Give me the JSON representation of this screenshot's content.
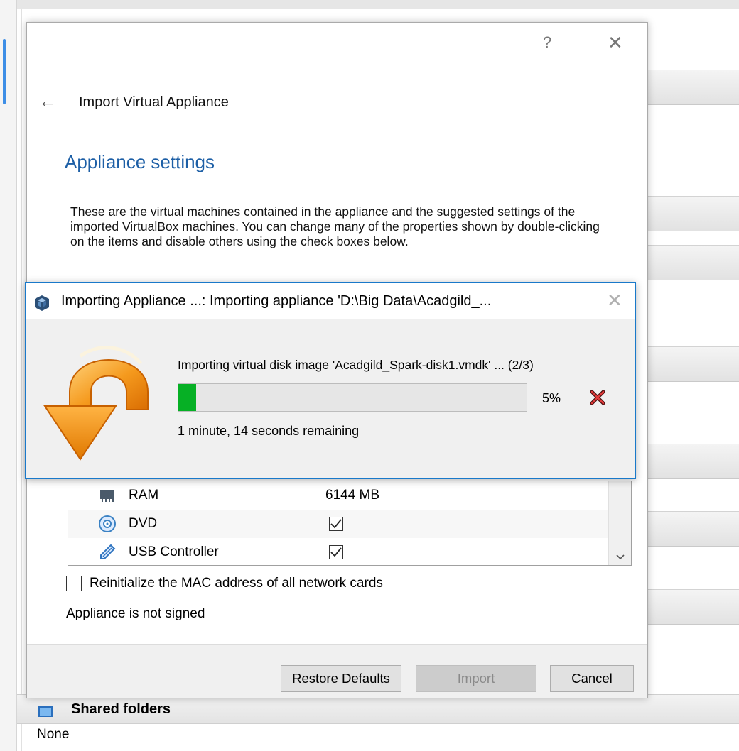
{
  "background": {
    "shared_folders_label": "Shared folders",
    "shared_folders_value": "None"
  },
  "dialog": {
    "help_glyph": "?",
    "close_glyph": "✕",
    "back_glyph": "←",
    "title": "Import Virtual Appliance",
    "section_title": "Appliance settings",
    "description": "These are the virtual machines contained in the appliance and the suggested settings of the imported VirtualBox machines. You can change many of the properties shown by double-clicking on the items and disable others using the check boxes below.",
    "rows": [
      {
        "icon": "ram-icon",
        "label": "RAM",
        "value": "6144 MB"
      },
      {
        "icon": "dvd-icon",
        "label": "DVD",
        "checked": true
      },
      {
        "icon": "usb-controller-icon",
        "label": "USB Controller",
        "checked": true
      }
    ],
    "mac_label": "Reinitialize the MAC address of all network cards",
    "signed_status": "Appliance is not signed",
    "buttons": {
      "restore": "Restore Defaults",
      "import": "Import",
      "cancel": "Cancel"
    }
  },
  "progress": {
    "title": "Importing Appliance ...: Importing appliance 'D:\\Big Data\\Acadgild_...",
    "close_glyph": "✕",
    "operation": "Importing virtual disk image 'Acadgild_Spark-disk1.vmdk' ... (2/3)",
    "percent_value": 5,
    "percent_label": "5%",
    "remaining": "1 minute, 14 seconds remaining"
  },
  "colors": {
    "accent": "#1d5fa6",
    "progress_fill": "#06b025",
    "window_border": "#1979ca"
  }
}
